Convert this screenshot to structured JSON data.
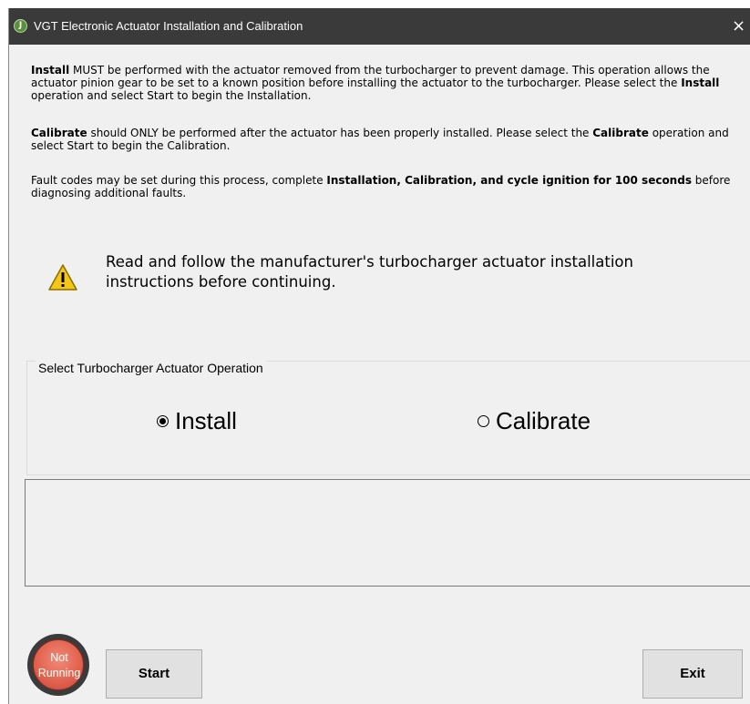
{
  "window": {
    "title": "VGT Electronic Actuator Installation and Calibration",
    "close_glyph": "×",
    "icon": "app-logo-icon"
  },
  "instructions": {
    "install_bold": "Install",
    "install_text_1": " MUST be performed with the actuator removed from the turbocharger to prevent damage. This operation allows the actuator pinion gear to be set to a known position before installing the actuator to the turbocharger. Please select the ",
    "install_bold_2": "Install",
    "install_text_2": " operation and select Start to begin the Installation.",
    "calibrate_bold": "Calibrate",
    "calibrate_text_1": " should ONLY be performed after the actuator has been properly installed.  Please select the ",
    "calibrate_bold_2": "Calibrate",
    "calibrate_text_2": " operation and select Start to begin the Calibration.",
    "fault_text_1": "Fault codes may be set during this process, complete ",
    "fault_bold": "Installation, Calibration, and cycle ignition for 100 seconds",
    "fault_text_2": " before diagnosing additional faults."
  },
  "warning": {
    "icon": "warning-triangle-icon",
    "text": "Read and follow the manufacturer's turbocharger actuator installation instructions before continuing."
  },
  "operation": {
    "group_label": "Select Turbocharger Actuator Operation",
    "options": [
      {
        "label": "Install",
        "selected": true
      },
      {
        "label": "Calibrate",
        "selected": false
      }
    ]
  },
  "status": {
    "text": "Not Running",
    "color": "#e26450"
  },
  "buttons": {
    "start": "Start",
    "exit": "Exit"
  }
}
